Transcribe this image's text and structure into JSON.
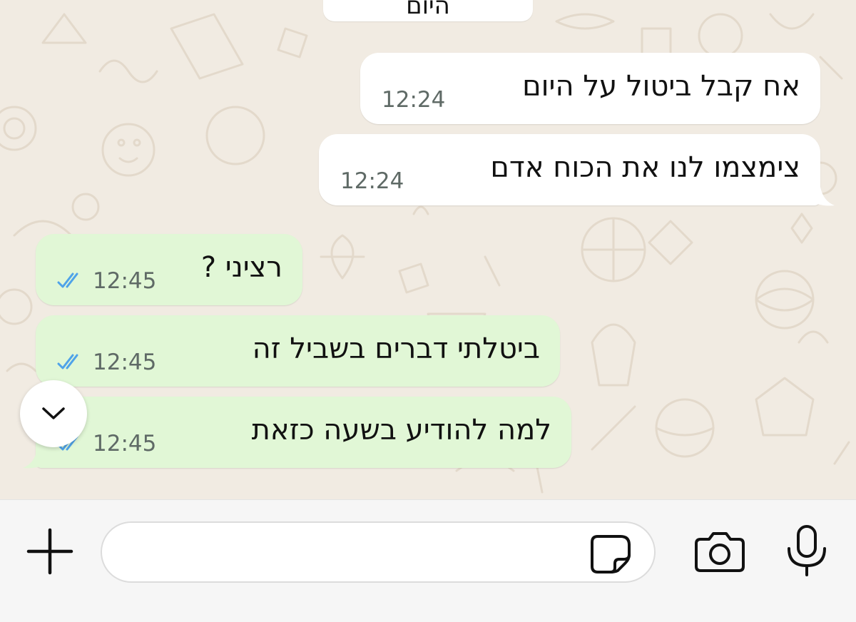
{
  "date_chip": {
    "label": "היום"
  },
  "messages": [
    {
      "direction": "incoming",
      "text": "אח קבל ביטול על היום",
      "time": "12:24"
    },
    {
      "direction": "incoming",
      "text": "צימצמו לנו את הכוח אדם",
      "time": "12:24"
    },
    {
      "direction": "outgoing",
      "text": "רציני ?",
      "time": "12:45",
      "status": "read"
    },
    {
      "direction": "outgoing",
      "text": "ביטלתי דברים בשביל זה",
      "time": "12:45",
      "status": "read"
    },
    {
      "direction": "outgoing",
      "text": "למה להודיע בשעה כזאת",
      "time": "12:45",
      "status": "read"
    }
  ],
  "input": {
    "value": "",
    "placeholder": ""
  },
  "icons": {
    "scroll_down": "chevron-down-icon",
    "attach": "plus-icon",
    "sticker": "sticker-icon",
    "camera": "camera-icon",
    "mic": "microphone-icon",
    "read_receipt": "double-check-icon"
  },
  "colors": {
    "wallpaper": "#f1ebe2",
    "incoming_bubble": "#ffffff",
    "outgoing_bubble": "#e1f7d6",
    "read_ticks": "#4fa3e9",
    "icon": "#111111"
  }
}
